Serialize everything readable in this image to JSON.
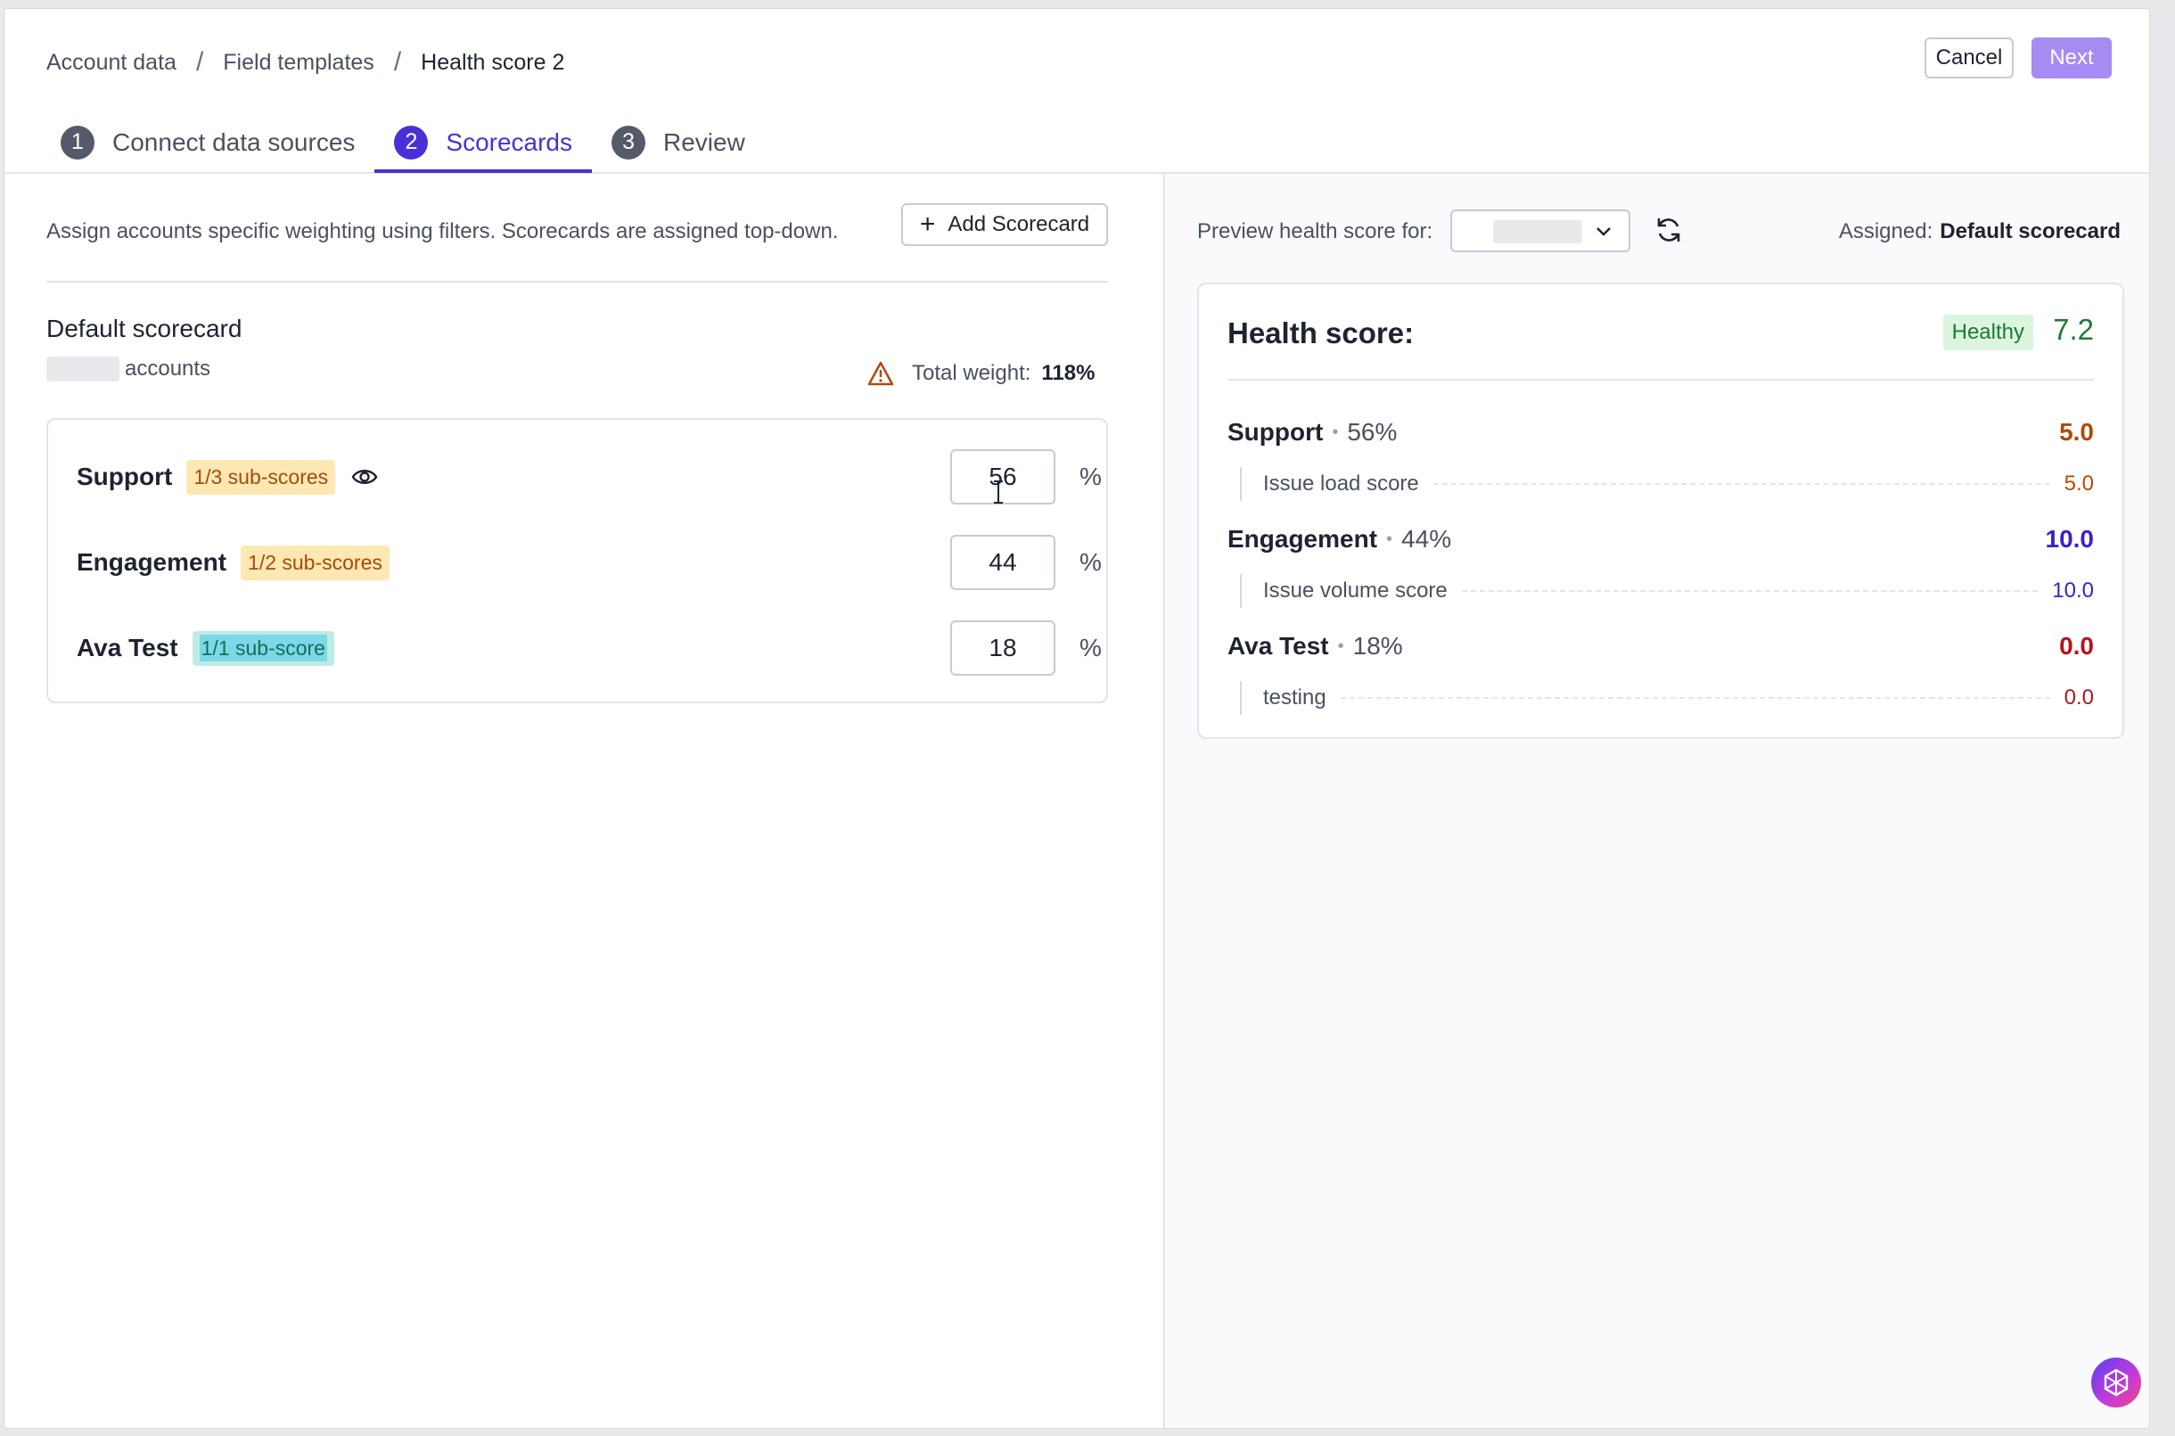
{
  "breadcrumb": {
    "items": [
      "Account data",
      "Field templates"
    ],
    "current": "Health score 2",
    "separator": "/"
  },
  "header": {
    "cancel_label": "Cancel",
    "next_label": "Next"
  },
  "tabs": [
    {
      "num": "1",
      "label": "Connect data sources"
    },
    {
      "num": "2",
      "label": "Scorecards"
    },
    {
      "num": "3",
      "label": "Review"
    }
  ],
  "left": {
    "assign_text": "Assign accounts specific weighting using filters. Scorecards are assigned top-down.",
    "add_scorecard_label": "Add Scorecard",
    "scorecard_title": "Default scorecard",
    "accounts_label": "accounts",
    "total_weight_label": "Total weight:",
    "total_weight_value": "118%",
    "rows": [
      {
        "name": "Support",
        "badge": "1/3 sub-scores",
        "value": "56",
        "pct": "%"
      },
      {
        "name": "Engagement",
        "badge": "1/2 sub-scores",
        "value": "44",
        "pct": "%"
      },
      {
        "name": "Ava Test",
        "badge": "1/1 sub-score",
        "value": "18",
        "pct": "%"
      }
    ]
  },
  "right": {
    "preview_label": "Preview health score for:",
    "assigned_label": "Assigned:",
    "assigned_value": "Default scorecard",
    "health_title": "Health score:",
    "health_status": "Healthy",
    "health_value": "7.2",
    "categories": [
      {
        "name": "Support",
        "pct": "56%",
        "value": "5.0",
        "sub_name": "Issue load score",
        "sub_value": "5.0"
      },
      {
        "name": "Engagement",
        "pct": "44%",
        "value": "10.0",
        "sub_name": "Issue volume score",
        "sub_value": "10.0"
      },
      {
        "name": "Ava Test",
        "pct": "18%",
        "value": "0.0",
        "sub_name": "testing",
        "sub_value": "0.0"
      }
    ]
  },
  "colors": {
    "accent": "#4b2fd6",
    "next_button": "#a58bf2",
    "healthy": "#1e7a35",
    "support": "#b04a0b",
    "engagement": "#3a22c7",
    "ava": "#b5121b"
  },
  "icons": [
    "warning-icon",
    "eye-icon",
    "plus-icon",
    "chevron-down-icon",
    "refresh-icon",
    "assistant-icon"
  ]
}
